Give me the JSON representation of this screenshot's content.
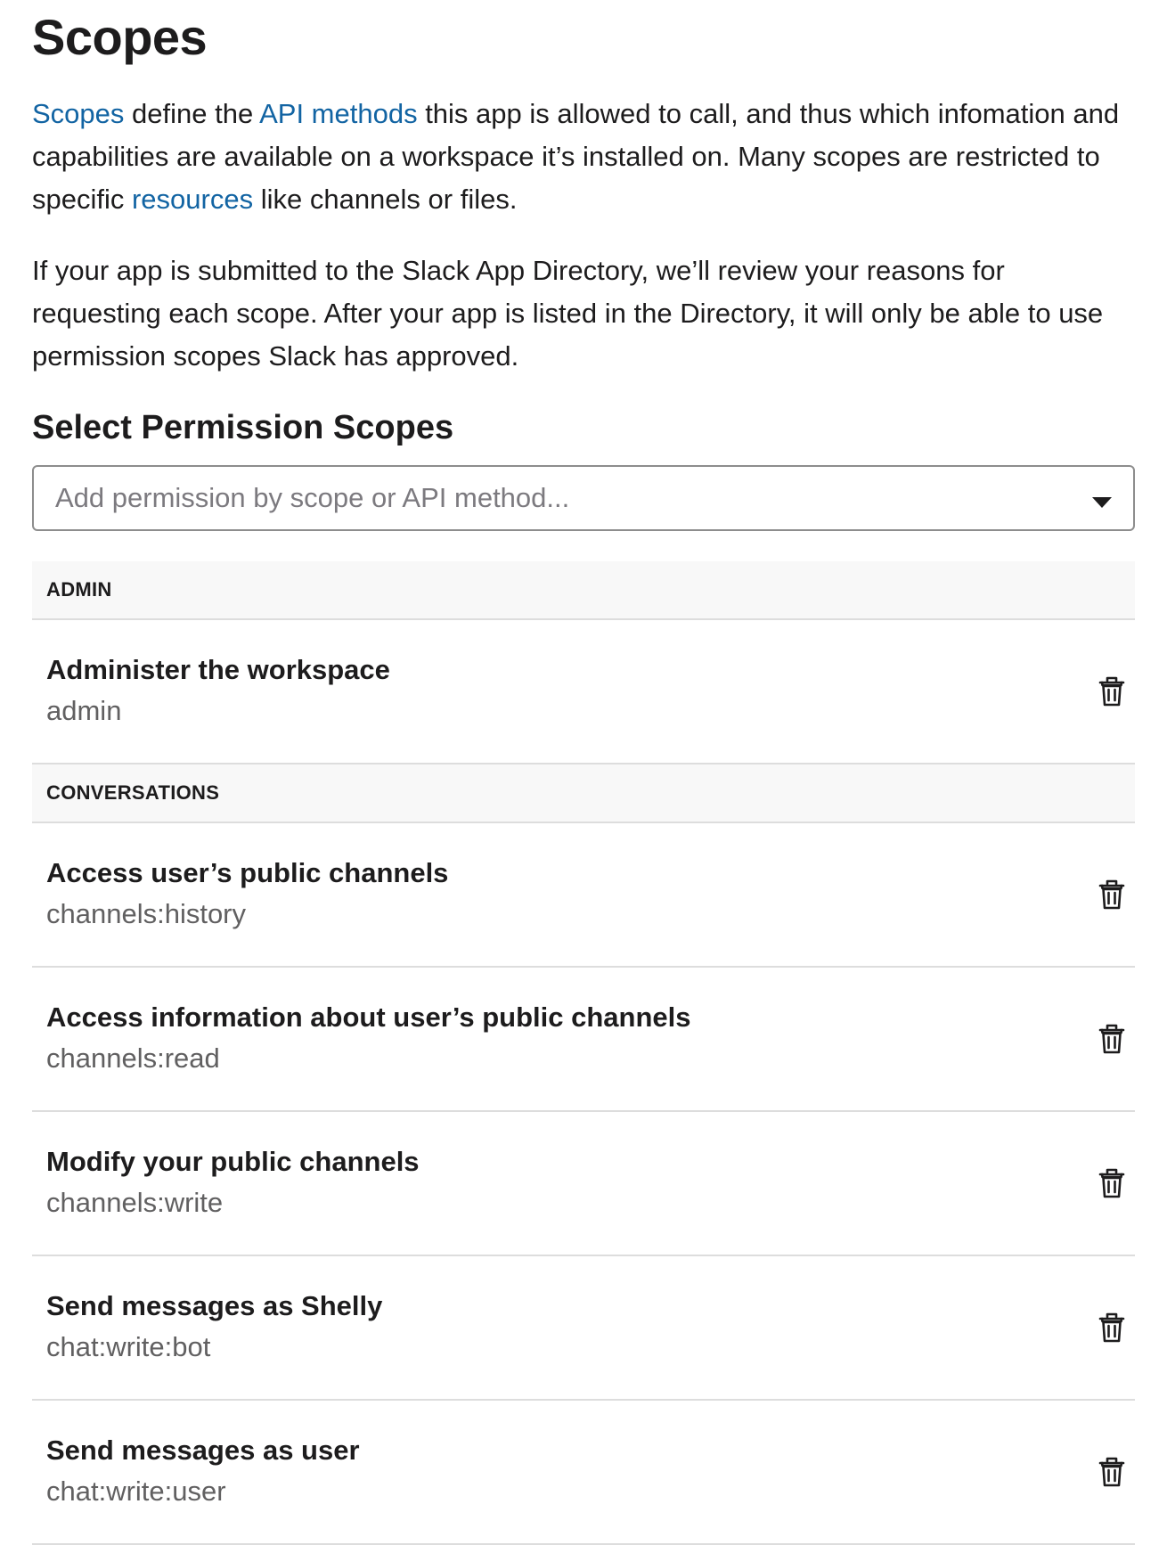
{
  "title": "Scopes",
  "intro1": {
    "link_scopes": "Scopes",
    "text1": " define the ",
    "link_api_methods": "API methods",
    "text2": " this app is allowed to call, and thus which infomation and capabilities are available on a workspace it’s installed on. Many scopes are restricted to specific ",
    "link_resources": "resources",
    "text3": " like channels or files."
  },
  "intro2": "If your app is submitted to the Slack App Directory, we’ll review your reasons for requesting each scope. After your app is listed in the Directory, it will only be able to use permission scopes Slack has approved.",
  "select_section": {
    "heading": "Select Permission Scopes",
    "placeholder": "Add permission by scope or API method...",
    "caret_icon": "caret-down-icon"
  },
  "colors": {
    "link": "#1264a3",
    "header_bg": "#f8f8f8",
    "divider": "#dddddd",
    "muted_text": "#616061"
  },
  "groups": [
    {
      "label": "ADMIN",
      "scopes": [
        {
          "name": "Administer the workspace",
          "id": "admin",
          "icon": "trash-icon"
        }
      ]
    },
    {
      "label": "CONVERSATIONS",
      "scopes": [
        {
          "name": "Access user’s public channels",
          "id": "channels:history",
          "icon": "trash-icon"
        },
        {
          "name": "Access information about user’s public channels",
          "id": "channels:read",
          "icon": "trash-icon"
        },
        {
          "name": "Modify your public channels",
          "id": "channels:write",
          "icon": "trash-icon"
        },
        {
          "name": "Send messages as Shelly",
          "id": "chat:write:bot",
          "icon": "trash-icon"
        },
        {
          "name": "Send messages as user",
          "id": "chat:write:user",
          "icon": "trash-icon"
        }
      ]
    }
  ]
}
